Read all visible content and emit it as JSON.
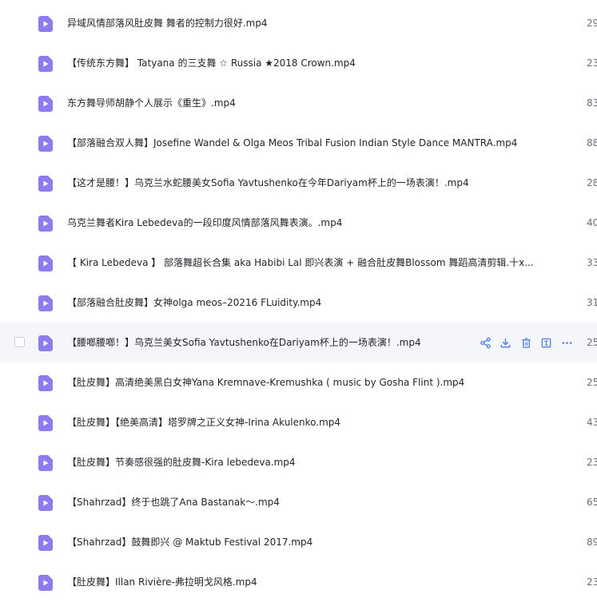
{
  "rows": [
    {
      "name": "异域风情部落风肚皮舞 舞者的控制力很好.mp4",
      "size": "29"
    },
    {
      "name": "【传统东方舞】 Tatyana 的三支舞 ☆ Russia ★2018 Crown.mp4",
      "size": "23"
    },
    {
      "name": "东方舞导师胡静个人展示《重生》.mp4",
      "size": "83"
    },
    {
      "name": "【部落融合双人舞】Josefine Wandel & Olga Meos Tribal Fusion Indian Style Dance MANTRA.mp4",
      "size": "88"
    },
    {
      "name": "【这才是腰！】乌克兰水蛇腰美女Sofia Yavtushenko在今年Dariyam杯上的一场表演！.mp4",
      "size": "28"
    },
    {
      "name": "乌克兰舞者Kira Lebedeva的一段印度风情部落风舞表演。.mp4",
      "size": "40"
    },
    {
      "name": "【 Kira Lebedeva 】 部落舞超长合集 aka Habibi Lal 即兴表演 + 融合肚皮舞Blossom 舞蹈高清剪辑.十x...",
      "size": "33"
    },
    {
      "name": "【部落融合肚皮舞】女神olga meos–20216 FLuidity.mp4",
      "size": "31"
    },
    {
      "name": "【腰啷腰啷！】乌克兰美女Sofia Yavtushenko在Dariyam杯上的一场表演！.mp4",
      "size": "25"
    },
    {
      "name": "【肚皮舞】高清绝美黑白女神Yana Kremnave-Kremushka ( music by Gosha Flint ).mp4",
      "size": "25"
    },
    {
      "name": "【肚皮舞】【绝美高清】塔罗牌之正义女神-Irina Akulenko.mp4",
      "size": "43"
    },
    {
      "name": "【肚皮舞】节奏感很强的肚皮舞-Kira lebedeva.mp4",
      "size": "23"
    },
    {
      "name": "【Shahrzad】终于也跳了Ana Bastanak～.mp4",
      "size": "65"
    },
    {
      "name": "【Shahrzad】鼓舞即兴 @ Maktub Festival 2017.mp4",
      "size": "89"
    },
    {
      "name": "【肚皮舞】Illan Rivière-弗拉明戈风格.mp4",
      "size": "23"
    }
  ],
  "hover_row_index": 8,
  "row_actions": [
    "share-icon",
    "download-icon",
    "delete-icon",
    "rename-icon",
    "more-icon"
  ],
  "colors": {
    "file_icon": "#8b7cf0",
    "action_icon": "#4f7cf7",
    "hover_bg": "#f5f6fa"
  }
}
